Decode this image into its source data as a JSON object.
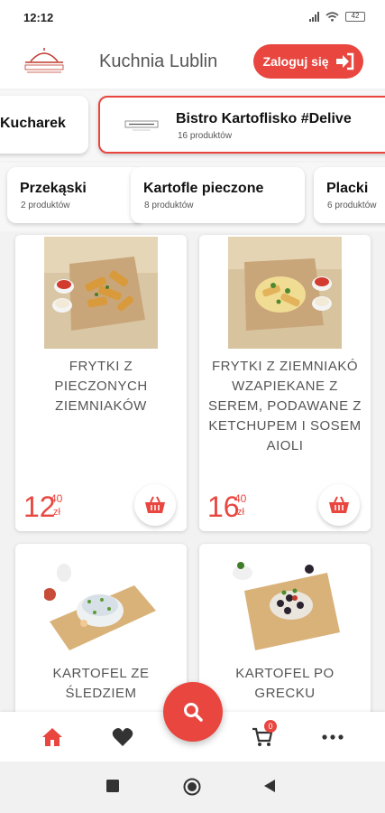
{
  "status_bar": {
    "time": "12:12",
    "battery": "42"
  },
  "header": {
    "title": "Kuchnia Lublin",
    "login_label": "Zaloguj się"
  },
  "restaurants": [
    {
      "name": "Kucharek"
    },
    {
      "name": "Bistro Kartoflisko #Delive",
      "count": "16 produktów"
    }
  ],
  "categories": [
    {
      "name": "Przekąski",
      "count": "2 produktów"
    },
    {
      "name": "Kartofle pieczone",
      "count": "8 produktów"
    },
    {
      "name": "Placki",
      "count": "6 produktów"
    }
  ],
  "products": [
    {
      "name": "FRYTKI Z PIECZONYCH ZIEMNIAKÓW",
      "price_main": "12",
      "price_cents": "40",
      "currency": "zł"
    },
    {
      "name": "FRYTKI Z ZIEMNIAKÓ WZAPIEKANE Z SEREM, PODAWANE Z KETCHUPEM I SOSEM AIOLI",
      "price_main": "16",
      "price_cents": "40",
      "currency": "zł"
    },
    {
      "name": "KARTOFEL ZE ŚLEDZIEM"
    },
    {
      "name": "KARTOFEL PO GRECKU"
    }
  ],
  "cart": {
    "count": "0"
  },
  "colors": {
    "accent": "#e8463f",
    "text_dark": "#111111",
    "text_muted": "#555555"
  },
  "icons": [
    "home-icon",
    "heart-icon",
    "search-icon",
    "cart-icon",
    "more-icon",
    "basket-icon",
    "login-arrow-icon"
  ]
}
